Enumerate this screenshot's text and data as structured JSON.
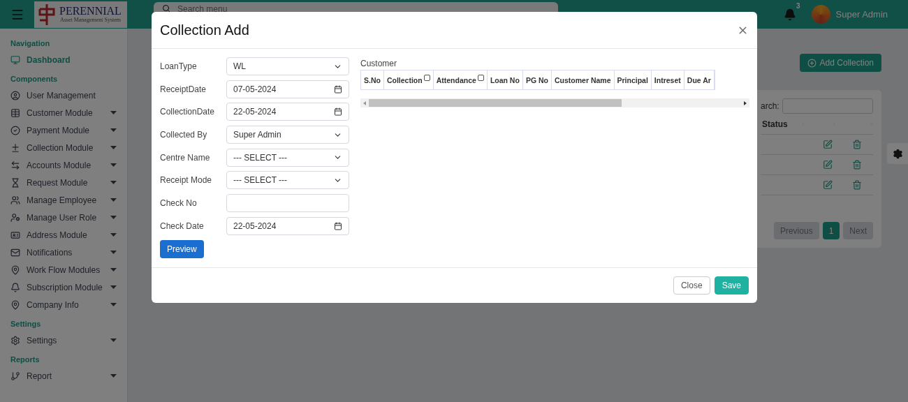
{
  "header": {
    "logo": {
      "title": "PERENNIAL",
      "subtitle": "Asset Management System"
    },
    "search": {
      "placeholder": "Search menu"
    },
    "notifications": {
      "count": "3"
    },
    "user": {
      "name": "Super Admin"
    }
  },
  "sidebar": {
    "sections": [
      {
        "title": "Navigation",
        "items": [
          {
            "label": "Dashboard",
            "selected": true,
            "has_submenu": false
          }
        ]
      },
      {
        "title": "Components",
        "items": [
          {
            "label": "User Management",
            "selected": false,
            "has_submenu": false
          },
          {
            "label": "Customer Module",
            "selected": false,
            "has_submenu": true
          },
          {
            "label": "Payment Module",
            "selected": false,
            "has_submenu": true
          },
          {
            "label": "Collection Module",
            "selected": false,
            "has_submenu": true
          },
          {
            "label": "Accounts Module",
            "selected": false,
            "has_submenu": true
          },
          {
            "label": "Request Module",
            "selected": false,
            "has_submenu": true
          },
          {
            "label": "Manage Employee",
            "selected": false,
            "has_submenu": true
          },
          {
            "label": "Manage User Role",
            "selected": false,
            "has_submenu": true
          },
          {
            "label": "Address Module",
            "selected": false,
            "has_submenu": true
          },
          {
            "label": "Notifications",
            "selected": false,
            "has_submenu": true
          },
          {
            "label": "Work Flow Modules",
            "selected": false,
            "has_submenu": true
          },
          {
            "label": "Subscription Module",
            "selected": false,
            "has_submenu": true
          },
          {
            "label": "Company Info",
            "selected": false,
            "has_submenu": true
          }
        ]
      },
      {
        "title": "Settings",
        "items": [
          {
            "label": "Settings",
            "selected": false,
            "has_submenu": true
          }
        ]
      },
      {
        "title": "Reports",
        "items": [
          {
            "label": "Report",
            "selected": false,
            "has_submenu": true
          }
        ]
      }
    ]
  },
  "page": {
    "add_button": "Add Collection",
    "table": {
      "search_label": "arch:",
      "status_column": "Status",
      "rows": [
        {
          "kind": "actions"
        },
        {
          "kind": "actions"
        },
        {
          "kind": "actions"
        }
      ]
    },
    "pagination": {
      "previous": "Previous",
      "pages": [
        {
          "label": "1",
          "selected": true
        }
      ],
      "next": "Next"
    }
  },
  "modal": {
    "title": "Collection Add",
    "fields": [
      {
        "label": "LoanType",
        "kind": "select",
        "value": "WL"
      },
      {
        "label": "ReceiptDate",
        "kind": "date",
        "value": "07-05-2024"
      },
      {
        "label": "CollectionDate",
        "kind": "date",
        "value": "22-05-2024"
      },
      {
        "label": "Collected By",
        "kind": "select",
        "value": "Super Admin"
      },
      {
        "label": "Centre Name",
        "kind": "select",
        "value": "--- SELECT ---"
      },
      {
        "label": "Receipt Mode",
        "kind": "select",
        "value": "--- SELECT ---"
      },
      {
        "label": "Check No",
        "kind": "text"
      },
      {
        "label": "Check Date",
        "kind": "date",
        "value": "22-05-2024"
      }
    ],
    "preview_button": "Preview",
    "customer_table": {
      "title": "Customer",
      "columns": [
        {
          "label": "S.No",
          "kind": "text"
        },
        {
          "label": "Collection",
          "kind": "checkbox",
          "checked": false
        },
        {
          "label": "Attendance",
          "kind": "checkbox",
          "checked": false
        },
        {
          "label": "Loan No",
          "kind": "text"
        },
        {
          "label": "PG No",
          "kind": "text"
        },
        {
          "label": "Customer Name",
          "kind": "text"
        },
        {
          "label": "Principal",
          "kind": "text"
        },
        {
          "label": "Intreset",
          "kind": "text"
        },
        {
          "label": "Due Ar",
          "kind": "text"
        }
      ]
    },
    "buttons": [
      {
        "label": "Close",
        "kind": "secondary"
      },
      {
        "label": "Save",
        "kind": "primary"
      }
    ]
  }
}
